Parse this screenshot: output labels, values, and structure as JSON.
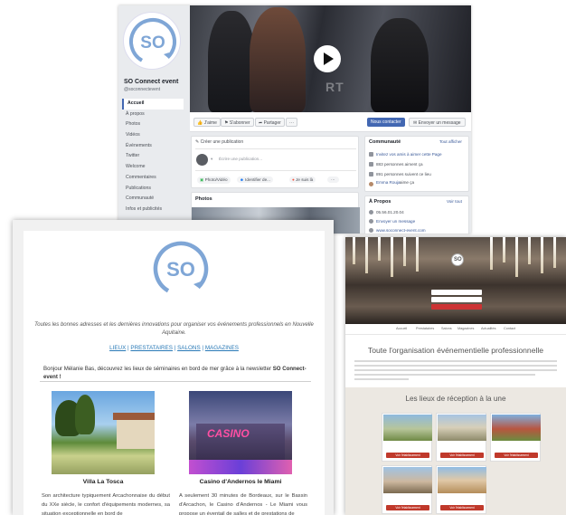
{
  "facebook": {
    "page_name": "SO Connect event",
    "handle": "@soconnectevent",
    "logo_text": "SO",
    "nav": [
      "Accueil",
      "À propos",
      "Photos",
      "Vidéos",
      "Événements",
      "Twitter",
      "Welcome",
      "Commentaires",
      "Publications",
      "Communauté",
      "Infos et publicités"
    ],
    "nav_active_index": 0,
    "video_watermark": "RT",
    "actions": {
      "like": "J'aime",
      "follow": "S'abonner",
      "share": "Partager",
      "more": "···"
    },
    "contact_button": "Nous contacter",
    "message_button": "Envoyer un message",
    "create_post": {
      "title": "Créer une publication",
      "placeholder": "Écrire une publication...",
      "photo_video": "Photo/Vidéo",
      "tag": "Identifier de...",
      "checkin": "Je suis là",
      "more": "···"
    },
    "photos_title": "Photos",
    "community": {
      "title": "Communauté",
      "see_all": "Tout afficher",
      "invite": "Invitez vos amis à aimer cette Page",
      "likes": "883 personnes aiment ça",
      "follows": "891 personnes suivent ce lieu",
      "friend_name": "Emma Rouja",
      "friend_likes": "aime ça"
    },
    "about": {
      "title": "À Propos",
      "see_all": "Voir tout",
      "phone": "05.56.01.20.04",
      "send_message": "Envoyer un message",
      "website": "www.soconnect-event.com"
    },
    "accent": "#4267b2"
  },
  "newsletter": {
    "logo_text": "SO",
    "tagline": "Toutes les bonnes adresses et les dernières innovations pour organiser vos événements professionnels en Nouvelle Aquitaine.",
    "links": [
      "LIEUX",
      "PRESTATAIRES",
      "SALONS",
      "MAGAZINES"
    ],
    "links_separator": " | ",
    "greeting_prefix": "Bonjour Mélanie Bas, découvrez les lieux de séminaires en bord de mer grâce à la newsletter ",
    "greeting_brand": "SO Connect-event",
    "greeting_suffix": " !",
    "venues": [
      {
        "name": "Villa La Tosca",
        "description": "Son architecture typiquement Arcachonnaise du début du XXe siècle, le confort d'équipements modernes, sa situation exceptionnelle en bord de"
      },
      {
        "name": "Casino d'Andernos le Miami",
        "description": "A seulement 30 minutes de Bordeaux, sur le Bassin d'Arcachon, le Casino d'Andernos - Le Miami vous propose un éventail de salles et de prestations de"
      }
    ],
    "casino_sign": "CASINO",
    "link_color": "#2a7ab7"
  },
  "website": {
    "logo_text": "SO",
    "nav": [
      "Accueil",
      "Prestataires",
      "Salons",
      "Magazines",
      "Actualités",
      "Contact"
    ],
    "headline": "Toute l'organisation événementielle professionnelle",
    "section_title": "Les lieux de réception à la une",
    "venue_button": "Voir l'établissement",
    "accent": "#c0392b"
  }
}
